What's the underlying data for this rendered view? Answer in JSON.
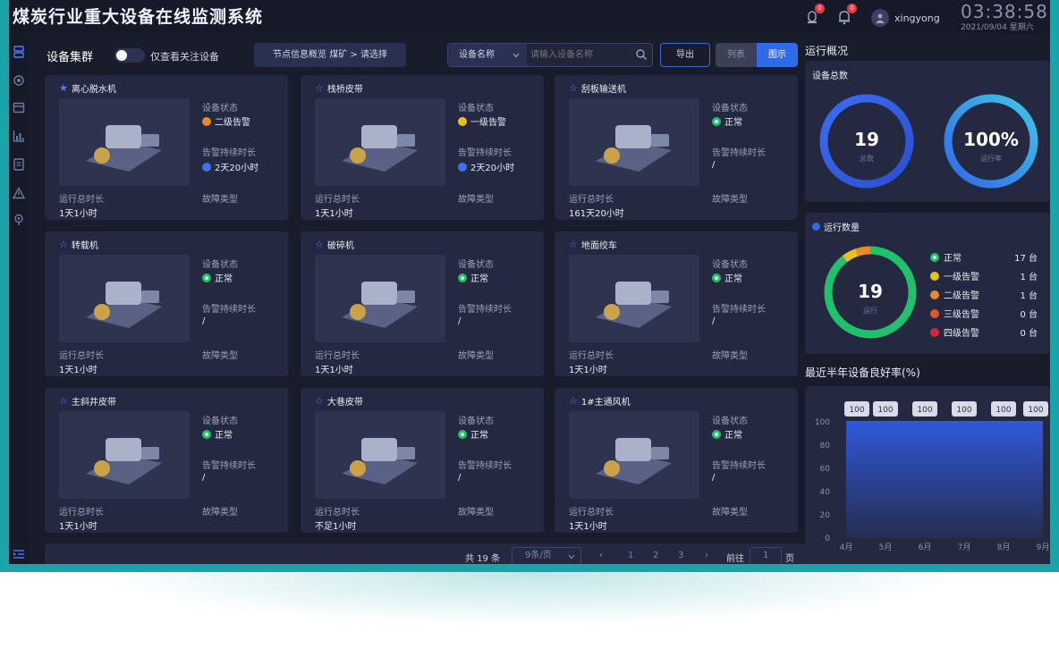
{
  "header": {
    "title": "煤炭行业重大设备在线监测系统",
    "alarm_badge": "0",
    "bell_badge": "0",
    "username": "xingyong",
    "time": "03:38:58",
    "date": "2021/09/04 星期六"
  },
  "toolbar": {
    "cluster_label": "设备集群",
    "toggle_label": "仅查看关注设备",
    "toggle_on": false,
    "breadcrumb": "节点信息概览 煤矿 > 请选择",
    "search_select": "设备名称",
    "search_placeholder": "请输入设备名称",
    "export_label": "导出",
    "view_list": "列表",
    "view_chart": "图示"
  },
  "card_labels": {
    "status": "设备状态",
    "alarm_duration": "告警持续时长",
    "run_total": "运行总时长",
    "fault_type": "故障类型"
  },
  "devices": [
    {
      "name": "离心脱水机",
      "starred": true,
      "status": "二级告警",
      "status_level": "a2",
      "alarm_duration": "2天20小时",
      "run_total": "1天1小时"
    },
    {
      "name": "栈桥皮带",
      "starred": false,
      "status": "一级告警",
      "status_level": "a1",
      "alarm_duration": "2天20小时",
      "run_total": "1天1小时"
    },
    {
      "name": "刮板输送机",
      "starred": false,
      "status": "正常",
      "status_level": "ok",
      "alarm_duration": "/",
      "run_total": "161天20小时"
    },
    {
      "name": "转载机",
      "starred": false,
      "status": "正常",
      "status_level": "ok",
      "alarm_duration": "/",
      "run_total": "1天1小时"
    },
    {
      "name": "破碎机",
      "starred": false,
      "status": "正常",
      "status_level": "ok",
      "alarm_duration": "/",
      "run_total": "1天1小时"
    },
    {
      "name": "地面绞车",
      "starred": false,
      "status": "正常",
      "status_level": "ok",
      "alarm_duration": "/",
      "run_total": "1天1小时"
    },
    {
      "name": "主斜井皮带",
      "starred": false,
      "status": "正常",
      "status_level": "ok",
      "alarm_duration": "/",
      "run_total": "1天1小时"
    },
    {
      "name": "大巷皮带",
      "starred": false,
      "status": "正常",
      "status_level": "ok",
      "alarm_duration": "/",
      "run_total": "不足1小时"
    },
    {
      "name": "1#主通风机",
      "starred": false,
      "status": "正常",
      "status_level": "ok",
      "alarm_duration": "/",
      "run_total": "1天1小时"
    }
  ],
  "pagination": {
    "total": "共 19 条",
    "page_size": "9条/页",
    "pages": [
      "1",
      "2",
      "3"
    ],
    "prev": "‹",
    "next": "›",
    "goto_label": "前往",
    "goto_value": "1",
    "page_unit": "页"
  },
  "overview": {
    "title": "运行概况",
    "total_title": "设备总数",
    "total_value": "19",
    "total_caption": "总数",
    "rate_value": "100%",
    "rate_caption": "运行率",
    "rate_fraction": 1.0,
    "count_title": "运行数量",
    "count_value": "19",
    "count_caption": "运行",
    "legend": [
      {
        "label": "正常",
        "count": "17 台",
        "level": "ok",
        "value": 17,
        "color": "#1fc26b"
      },
      {
        "label": "一级告警",
        "count": "1 台",
        "level": "a1",
        "value": 1,
        "color": "#e6c020"
      },
      {
        "label": "二级告警",
        "count": "1 台",
        "level": "a2",
        "value": 1,
        "color": "#e68a2a"
      },
      {
        "label": "三级告警",
        "count": "0 台",
        "level": "a3",
        "value": 0,
        "color": "#e0542e"
      },
      {
        "label": "四级告警",
        "count": "0 台",
        "level": "a4",
        "value": 0,
        "color": "#d02a38"
      }
    ]
  },
  "chart_data": {
    "type": "area",
    "title": "最近半年设备良好率(%)",
    "categories": [
      "4月",
      "5月",
      "6月",
      "7月",
      "8月",
      "9月"
    ],
    "values": [
      100,
      100,
      100,
      100,
      100,
      100
    ],
    "ylim": [
      0,
      100
    ],
    "yticks": [
      "0",
      "20",
      "40",
      "60",
      "80",
      "100"
    ],
    "data_labels": [
      "100",
      "100",
      "100",
      "100",
      "100",
      "100"
    ],
    "grid": false,
    "color": "#2f5be0"
  },
  "colors": {
    "accent": "#2f6ae8",
    "frame": "#1aa3a8",
    "background": "#191c2b",
    "card": "#242840"
  }
}
